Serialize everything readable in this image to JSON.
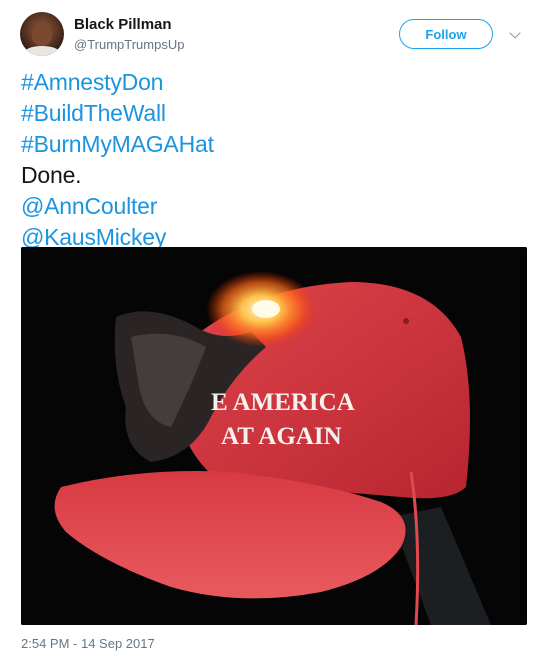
{
  "author": {
    "name": "Black Pillman",
    "handle": "@TrumpTrumpsUp"
  },
  "actions": {
    "follow_label": "Follow"
  },
  "tweet": {
    "lines": [
      {
        "text": "#AmnestyDon",
        "kind": "hashtag"
      },
      {
        "text": "#BuildTheWall",
        "kind": "hashtag"
      },
      {
        "text": "#BurnMyMAGAHat",
        "kind": "hashtag"
      },
      {
        "text": "Done.",
        "kind": "plain"
      },
      {
        "text": "@AnnCoulter",
        "kind": "mention"
      },
      {
        "text": "@KausMickey",
        "kind": "mention"
      }
    ],
    "timestamp": "2:54 PM - 14 Sep 2017"
  },
  "media": {
    "hat_text_line1": "E AMERICA",
    "hat_text_line2": "AT AGAIN"
  },
  "colors": {
    "link": "#1b95e0",
    "follow": "#1da1f2",
    "secondary_text": "#657786",
    "hat_red": "#d8303a"
  }
}
